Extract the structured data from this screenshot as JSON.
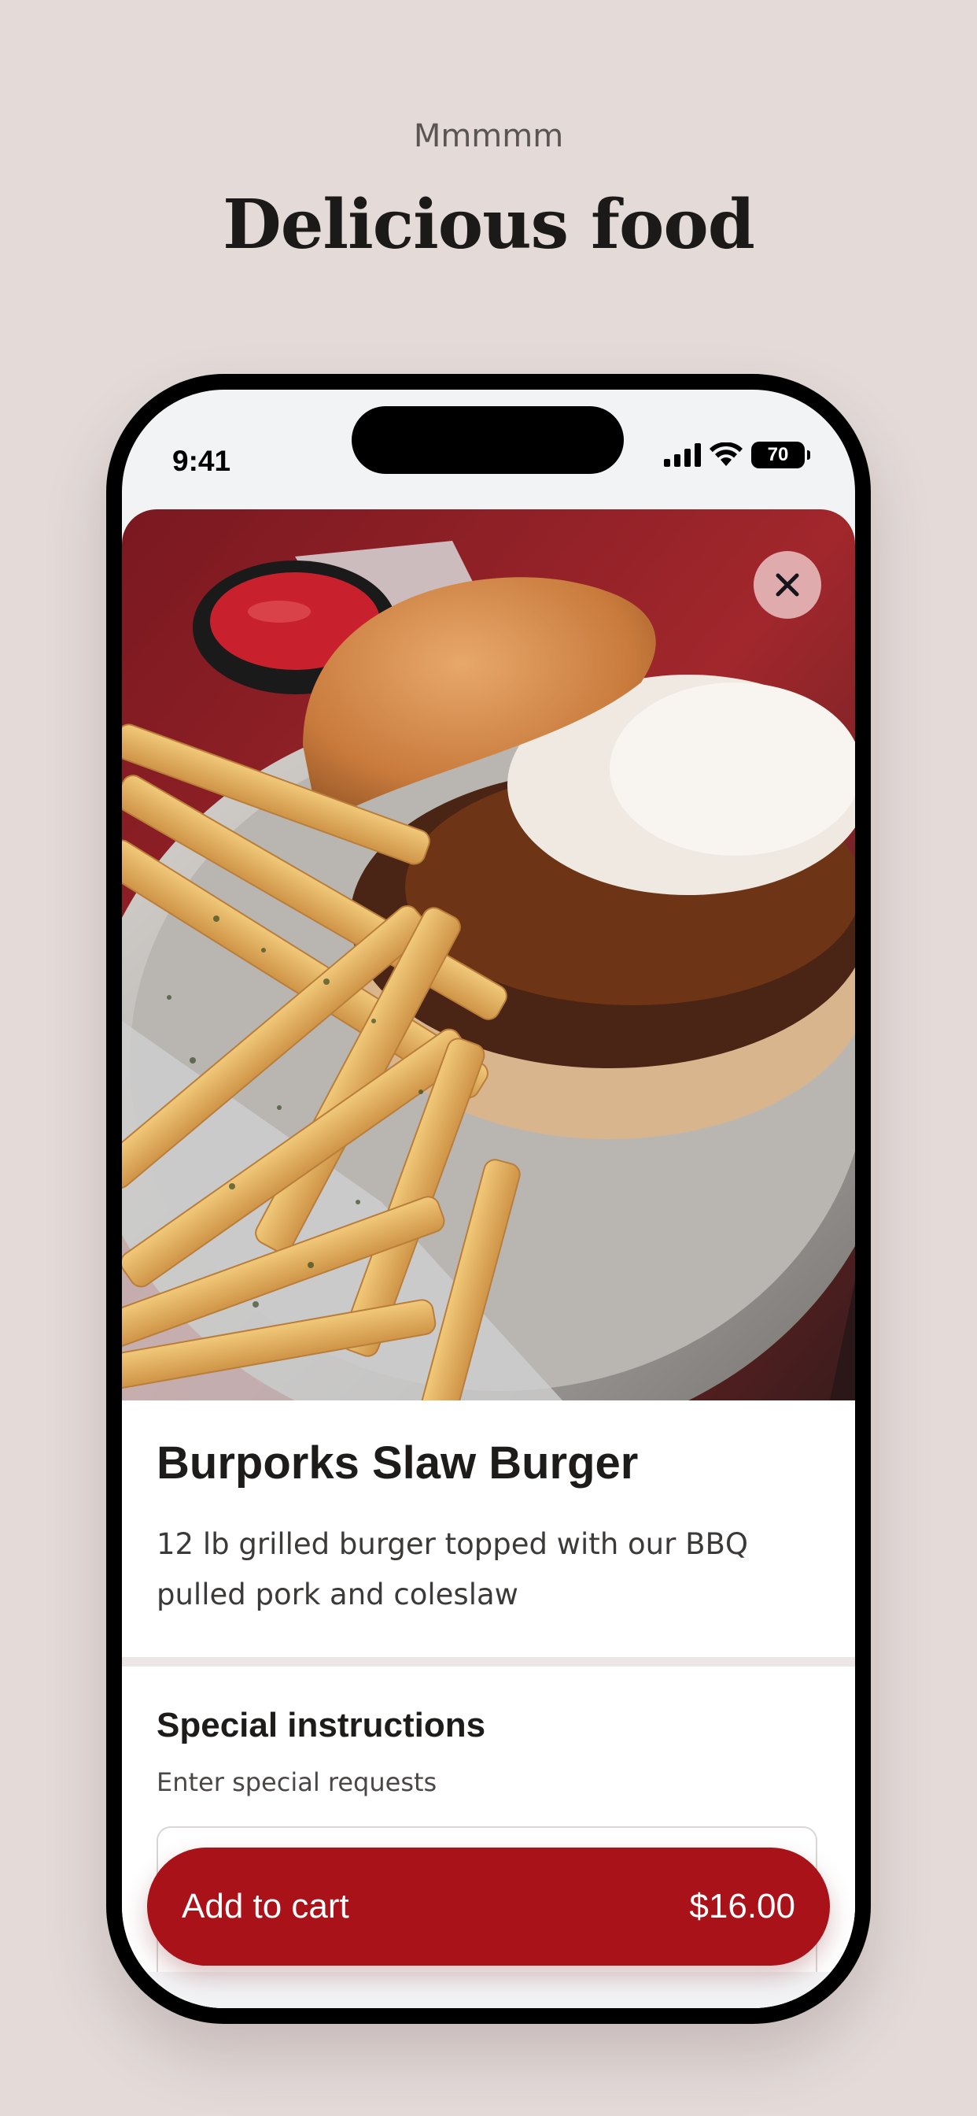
{
  "header": {
    "eyebrow": "Mmmmm",
    "headline": "Delicious food"
  },
  "status_bar": {
    "time": "9:41",
    "battery": "70",
    "icons": [
      "signal-icon",
      "wifi-icon",
      "battery-icon"
    ]
  },
  "item": {
    "title": "Burporks Slaw Burger",
    "description": "12 lb grilled burger topped with our BBQ pulled pork and coleslaw",
    "close_icon": "close-icon"
  },
  "special_instructions": {
    "title": "Special instructions",
    "subtitle": "Enter special requests",
    "value": ""
  },
  "cart_button": {
    "label": "Add to cart",
    "price": "$16.00"
  },
  "colors": {
    "background": "#e4dbd9",
    "accent": "#a81218",
    "text": "#1d1c1b"
  }
}
